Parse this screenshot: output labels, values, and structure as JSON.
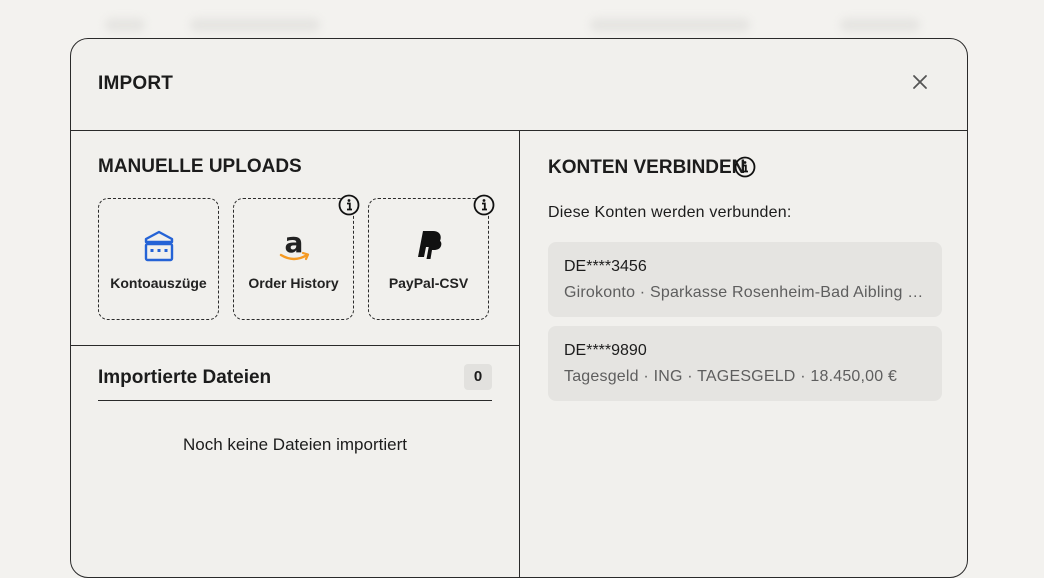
{
  "modal": {
    "title": "IMPORT"
  },
  "manual_uploads": {
    "title": "MANUELLE UPLOADS",
    "cards": [
      {
        "label": "Kontoauszüge",
        "icon": "bank-icon",
        "has_info": false
      },
      {
        "label": "Order History",
        "icon": "amazon-logo-icon",
        "has_info": true
      },
      {
        "label": "PayPal-CSV",
        "icon": "paypal-logo-icon",
        "has_info": true
      }
    ]
  },
  "imported_files": {
    "title": "Importierte Dateien",
    "count": "0",
    "empty_text": "Noch keine Dateien importiert"
  },
  "connect_accounts": {
    "title": "KONTEN VERBINDEN",
    "subtitle": "Diese Konten werden verbunden:",
    "accounts": [
      {
        "iban": "DE****3456",
        "details": "Girokonto · Sparkasse Rosenheim-Bad Aibling · G..."
      },
      {
        "iban": "DE****9890",
        "details": "Tagesgeld · ING · TAGESGELD · 18.450,00 €"
      }
    ]
  },
  "colors": {
    "bank_blue": "#2563d6",
    "amazon_orange": "#f59a23",
    "border": "#2a2a2a"
  }
}
